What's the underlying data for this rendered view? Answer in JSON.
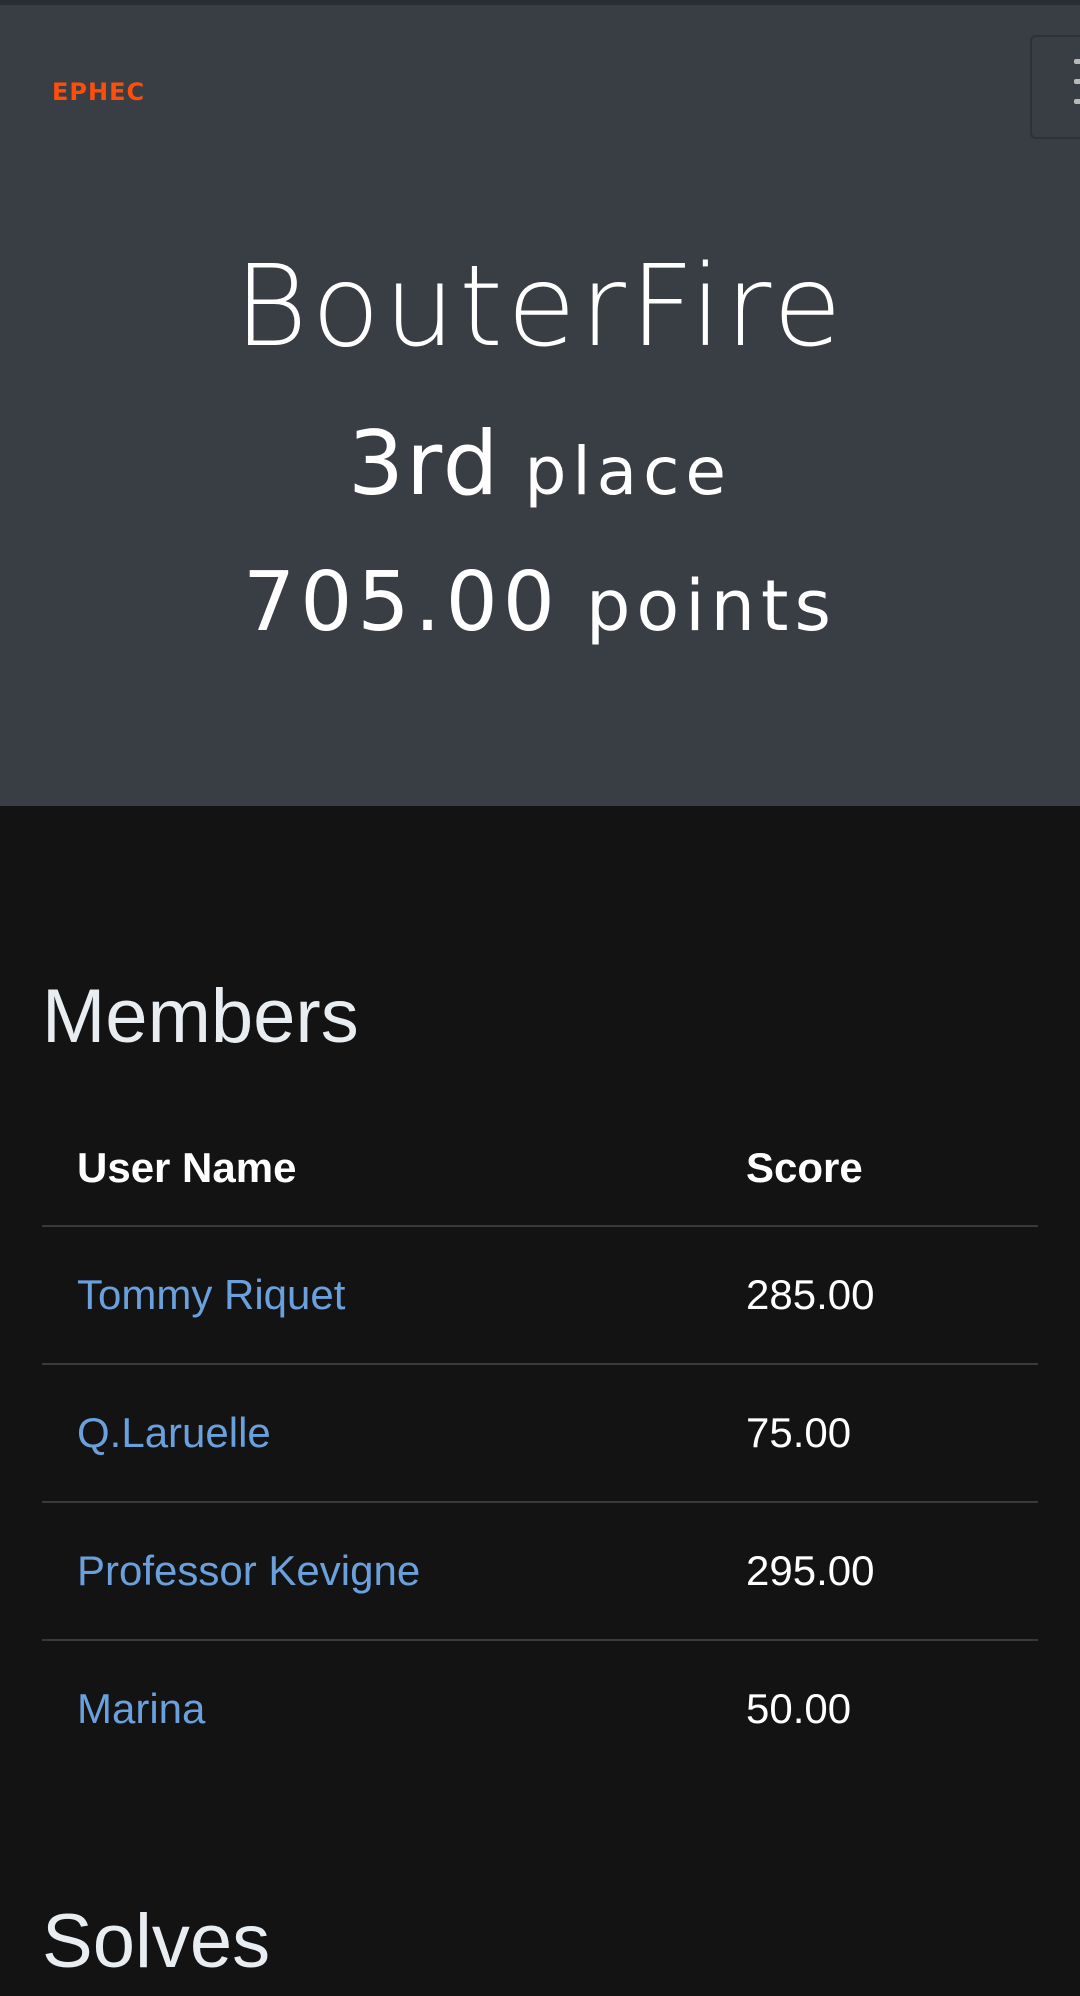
{
  "header": {
    "logo_text": "EPHEC",
    "logo_color": "#ff4e0a",
    "menu_icon": "hamburger-menu-icon"
  },
  "team": {
    "name": "BouterFire",
    "place_number": "3rd",
    "place_label": "place",
    "points_number": "705.00",
    "points_label": "points"
  },
  "members": {
    "title": "Members",
    "columns": [
      "User Name",
      "Score"
    ],
    "rows": [
      {
        "name": "Tommy Riquet",
        "score": "285.00"
      },
      {
        "name": "Q.Laruelle",
        "score": "75.00"
      },
      {
        "name": "Professor Kevigne",
        "score": "295.00"
      },
      {
        "name": "Marina",
        "score": "50.00"
      }
    ]
  },
  "solves": {
    "title": "Solves"
  },
  "colors": {
    "hero_bg": "#393d44",
    "page_bg": "#131313",
    "link": "#6aa1dd"
  }
}
